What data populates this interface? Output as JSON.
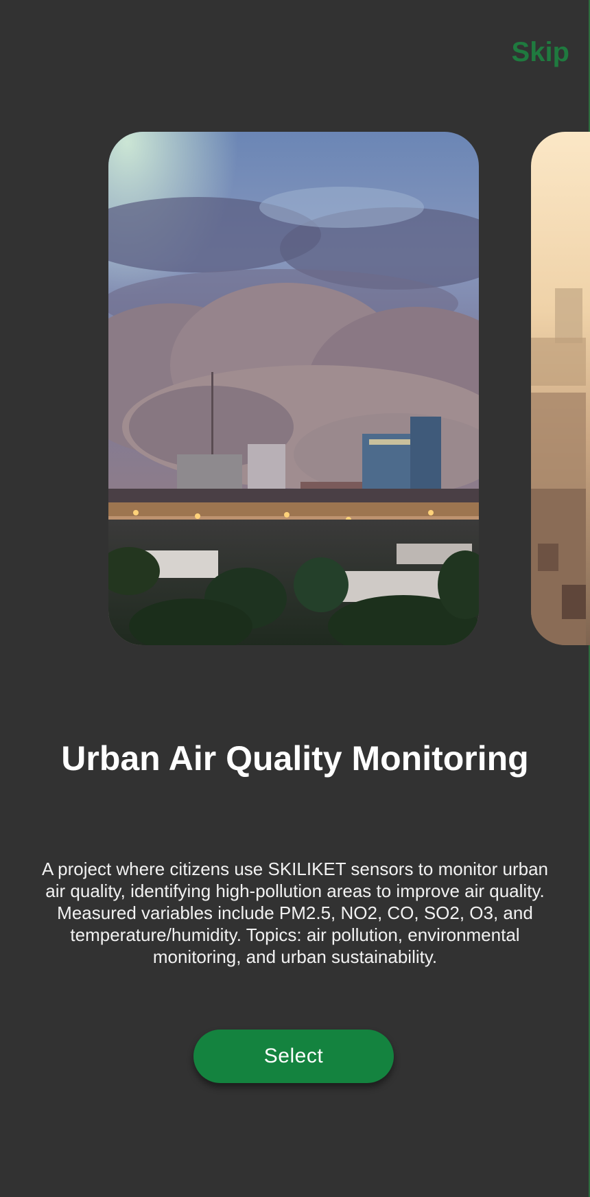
{
  "header": {
    "skip_label": "Skip"
  },
  "carousel": {
    "current": {
      "image_desc": "dust-storm-city-photo",
      "title": "Urban Air Quality Monitoring",
      "description": "A project where citizens use SKILIKET sensors to monitor urban air quality, identifying high-pollution areas to improve air quality. Measured variables include PM2.5, NO2, CO, SO2, O3, and temperature/humidity. Topics: air pollution, environmental monitoring, and urban sustainability."
    },
    "next": {
      "image_desc": "hazy-city-photo"
    }
  },
  "actions": {
    "select_label": "Select"
  },
  "colors": {
    "background": "#323232",
    "accent": "#14833f",
    "skip_text": "#1f7a3f"
  }
}
